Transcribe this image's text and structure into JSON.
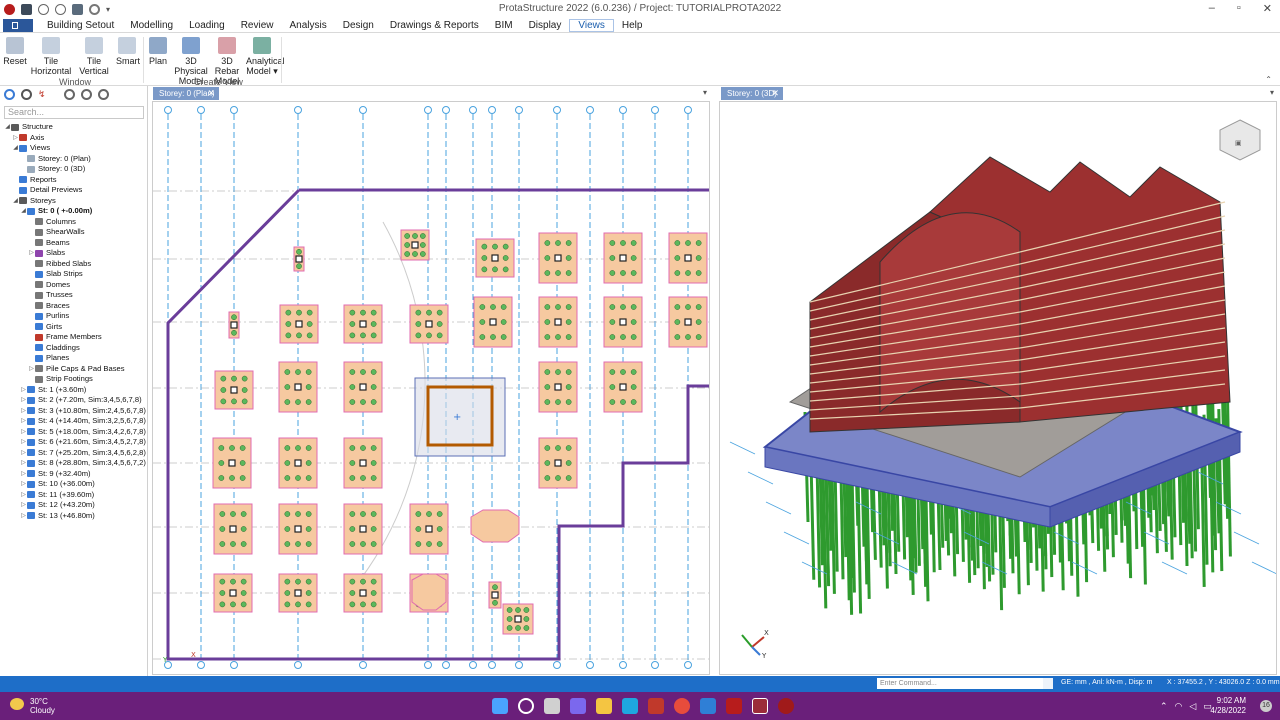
{
  "window": {
    "title": "ProtaStructure 2022 (6.0.236) / Project: TUTORIALPROTA2022",
    "controls": [
      "–",
      "▫",
      "✕"
    ]
  },
  "menu": {
    "items": [
      "Building Setout",
      "Modelling",
      "Loading",
      "Review",
      "Analysis",
      "Design",
      "Drawings & Reports",
      "BIM",
      "Display",
      "Views",
      "Help"
    ],
    "active": "Views"
  },
  "ribbon": {
    "window_group": "Window",
    "create_group": "Create View",
    "reset": "Reset",
    "tile_horizontal": "Tile Horizontal",
    "tile_vertical": "Tile Vertical",
    "smart": "Smart",
    "plan": "Plan",
    "physical_3d_l1": "3D Physical",
    "physical_3d_l2": "Model",
    "rebar_3d_l1": "3D Rebar",
    "rebar_3d_l2": "Model",
    "analytical_l1": "Analytical",
    "analytical_l2": "Model ▾"
  },
  "left_panel": {
    "search_placeholder": "Search...",
    "tree": [
      {
        "label": "Structure",
        "depth": 0,
        "expander": "◢",
        "bold": false,
        "color": "#5a5a5a"
      },
      {
        "label": "Axis",
        "depth": 1,
        "expander": "▷",
        "bold": false,
        "color": "#c0392b"
      },
      {
        "label": "Views",
        "depth": 1,
        "expander": "◢",
        "bold": false,
        "color": "#3a7bd5"
      },
      {
        "label": "Storey: 0 (Plan)",
        "depth": 2,
        "expander": "",
        "bold": false,
        "color": "#9ab"
      },
      {
        "label": "Storey: 0 (3D)",
        "depth": 2,
        "expander": "",
        "bold": false,
        "color": "#9ab"
      },
      {
        "label": "Reports",
        "depth": 1,
        "expander": "",
        "bold": false,
        "color": "#3a7bd5"
      },
      {
        "label": "Detail Previews",
        "depth": 1,
        "expander": "",
        "bold": false,
        "color": "#3a7bd5"
      },
      {
        "label": "Storeys",
        "depth": 1,
        "expander": "◢",
        "bold": false,
        "color": "#5a5a5a"
      },
      {
        "label": "St: 0 ( +-0.00m)",
        "depth": 2,
        "expander": "◢",
        "bold": true,
        "color": "#3a7bd5"
      },
      {
        "label": "Columns",
        "depth": 3,
        "expander": "",
        "bold": false,
        "color": "#777"
      },
      {
        "label": "ShearWalls",
        "depth": 3,
        "expander": "",
        "bold": false,
        "color": "#777"
      },
      {
        "label": "Beams",
        "depth": 3,
        "expander": "",
        "bold": false,
        "color": "#777"
      },
      {
        "label": "Slabs",
        "depth": 3,
        "expander": "▷",
        "bold": false,
        "color": "#8e44ad"
      },
      {
        "label": "Ribbed Slabs",
        "depth": 3,
        "expander": "",
        "bold": false,
        "color": "#777"
      },
      {
        "label": "Slab Strips",
        "depth": 3,
        "expander": "",
        "bold": false,
        "color": "#3a7bd5"
      },
      {
        "label": "Domes",
        "depth": 3,
        "expander": "",
        "bold": false,
        "color": "#777"
      },
      {
        "label": "Trusses",
        "depth": 3,
        "expander": "",
        "bold": false,
        "color": "#777"
      },
      {
        "label": "Braces",
        "depth": 3,
        "expander": "",
        "bold": false,
        "color": "#777"
      },
      {
        "label": "Purlins",
        "depth": 3,
        "expander": "",
        "bold": false,
        "color": "#3a7bd5"
      },
      {
        "label": "Girts",
        "depth": 3,
        "expander": "",
        "bold": false,
        "color": "#3a7bd5"
      },
      {
        "label": "Frame Members",
        "depth": 3,
        "expander": "",
        "bold": false,
        "color": "#c0392b"
      },
      {
        "label": "Claddings",
        "depth": 3,
        "expander": "",
        "bold": false,
        "color": "#3a7bd5"
      },
      {
        "label": "Planes",
        "depth": 3,
        "expander": "",
        "bold": false,
        "color": "#3a7bd5"
      },
      {
        "label": "Pile Caps & Pad Bases",
        "depth": 3,
        "expander": "▷",
        "bold": false,
        "color": "#777"
      },
      {
        "label": "Strip Footings",
        "depth": 3,
        "expander": "",
        "bold": false,
        "color": "#777"
      },
      {
        "label": "St: 1 (+3.60m)",
        "depth": 2,
        "expander": "▷",
        "bold": false,
        "color": "#3a7bd5"
      },
      {
        "label": "St: 2 (+7.20m, Sim:3,4,5,6,7,8)",
        "depth": 2,
        "expander": "▷",
        "bold": false,
        "color": "#3a7bd5"
      },
      {
        "label": "St: 3 (+10.80m, Sim:2,4,5,6,7,8)",
        "depth": 2,
        "expander": "▷",
        "bold": false,
        "color": "#3a7bd5"
      },
      {
        "label": "St: 4 (+14.40m, Sim:3,2,5,6,7,8)",
        "depth": 2,
        "expander": "▷",
        "bold": false,
        "color": "#3a7bd5"
      },
      {
        "label": "St: 5 (+18.00m, Sim:3,4,2,6,7,8)",
        "depth": 2,
        "expander": "▷",
        "bold": false,
        "color": "#3a7bd5"
      },
      {
        "label": "St: 6 (+21.60m, Sim:3,4,5,2,7,8)",
        "depth": 2,
        "expander": "▷",
        "bold": false,
        "color": "#3a7bd5"
      },
      {
        "label": "St: 7 (+25.20m, Sim:3,4,5,6,2,8)",
        "depth": 2,
        "expander": "▷",
        "bold": false,
        "color": "#3a7bd5"
      },
      {
        "label": "St: 8 (+28.80m, Sim:3,4,5,6,7,2)",
        "depth": 2,
        "expander": "▷",
        "bold": false,
        "color": "#3a7bd5"
      },
      {
        "label": "St: 9 (+32.40m)",
        "depth": 2,
        "expander": "▷",
        "bold": false,
        "color": "#3a7bd5"
      },
      {
        "label": "St: 10 (+36.00m)",
        "depth": 2,
        "expander": "▷",
        "bold": false,
        "color": "#3a7bd5"
      },
      {
        "label": "St: 11 (+39.60m)",
        "depth": 2,
        "expander": "▷",
        "bold": false,
        "color": "#3a7bd5"
      },
      {
        "label": "St: 12 (+43.20m)",
        "depth": 2,
        "expander": "▷",
        "bold": false,
        "color": "#3a7bd5"
      },
      {
        "label": "St: 13 (+46.80m)",
        "depth": 2,
        "expander": "▷",
        "bold": false,
        "color": "#3a7bd5"
      }
    ]
  },
  "tabs": {
    "plan": "Storey: 0 (Plan)",
    "view3d": "Storey: 0 (3D)"
  },
  "status": {
    "command_placeholder": "Enter Command...",
    "units": "GE: mm ,  Anl: kN-m ,  Disp: m",
    "coords": "X : 37455.2 , Y : 43026.0     Z : 0.0 mm"
  },
  "taskbar": {
    "temperature": "30°C",
    "weather": "Cloudy",
    "time": "9:02 AM",
    "date": "4/28/2022",
    "notifications": "16"
  },
  "colors": {
    "accent": "#1e6ec8",
    "taskbar": "#6a1f7a",
    "pile_cap_fill": "#f6c9a0",
    "pile_cap_border": "#e26bb0",
    "pile": "#5cb85c",
    "wall": "#6a3d9a",
    "grid_line": "#4aa3df"
  }
}
